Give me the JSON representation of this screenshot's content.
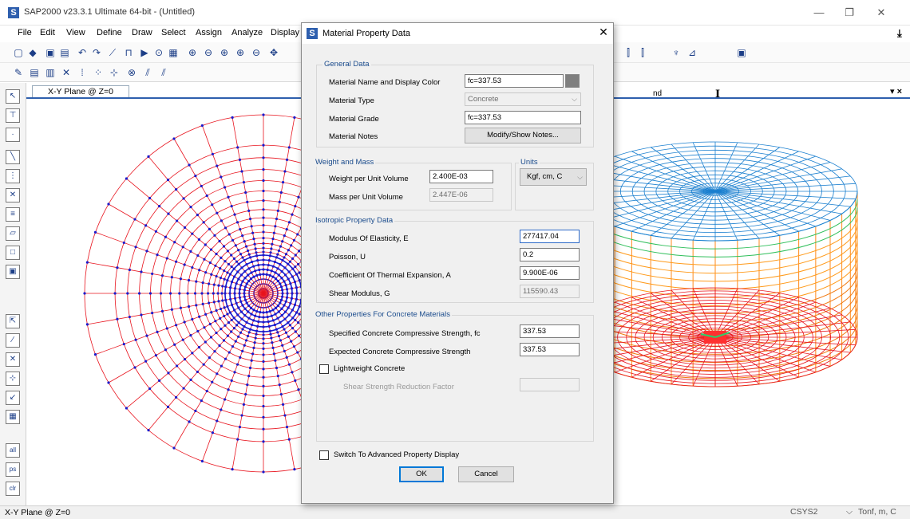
{
  "window": {
    "title": "SAP2000 v23.3.1 Ultimate 64-bit - (Untitled)",
    "logo": "S",
    "minimize": "—",
    "restore": "❐",
    "close": "✕"
  },
  "menu": [
    "File",
    "Edit",
    "View",
    "Define",
    "Draw",
    "Select",
    "Assign",
    "Analyze",
    "Display"
  ],
  "toolbar_right_text": {
    "nd": "nd",
    "draw_t": "I"
  },
  "view": {
    "tab_label": "X-Y Plane @ Z=0",
    "pin_close": "▾ ×"
  },
  "status": {
    "left": "X-Y Plane @ Z=0",
    "csys": "CSYS2",
    "units": "Tonf, m, C"
  },
  "colors": {
    "accent": "#2e5fae",
    "mesh_red": "#e8141e",
    "mesh_blue": "#1a1acc",
    "dialog_group_title": "#1a4b8c"
  },
  "dialog": {
    "title": "Material Property Data",
    "general": {
      "title": "General Data",
      "name_label": "Material Name and Display Color",
      "name_value": "fc=337.53",
      "display_color": "#7f7f7f",
      "type_label": "Material Type",
      "type_value": "Concrete",
      "grade_label": "Material Grade",
      "grade_value": "fc=337.53",
      "notes_label": "Material Notes",
      "notes_button": "Modify/Show Notes..."
    },
    "weight": {
      "title": "Weight and Mass",
      "wpuv_label": "Weight per Unit Volume",
      "wpuv_value": "2.400E-03",
      "mpuv_label": "Mass per Unit Volume",
      "mpuv_value": "2.447E-06"
    },
    "units": {
      "title": "Units",
      "value": "Kgf, cm, C"
    },
    "isotropic": {
      "title": "Isotropic Property Data",
      "e_label": "Modulus Of Elasticity,  E",
      "e_value": "277417.04",
      "u_label": "Poisson,  U",
      "u_value": "0.2",
      "a_label": "Coefficient Of Thermal Expansion,  A",
      "a_value": "9.900E-06",
      "g_label": "Shear Modulus,  G",
      "g_value": "115590.43"
    },
    "concrete": {
      "title": "Other Properties For Concrete Materials",
      "fc_label": "Specified Concrete Compressive Strength,  fc",
      "fc_value": "337.53",
      "efc_label": "Expected Concrete Compressive Strength",
      "efc_value": "337.53",
      "lw_label": "Lightweight Concrete",
      "lw_checked": false,
      "ssrf_label": "Shear Strength Reduction Factor",
      "ssrf_value": ""
    },
    "advanced_label": "Switch To Advanced Property Display",
    "advanced_checked": false,
    "ok": "OK",
    "cancel": "Cancel"
  }
}
